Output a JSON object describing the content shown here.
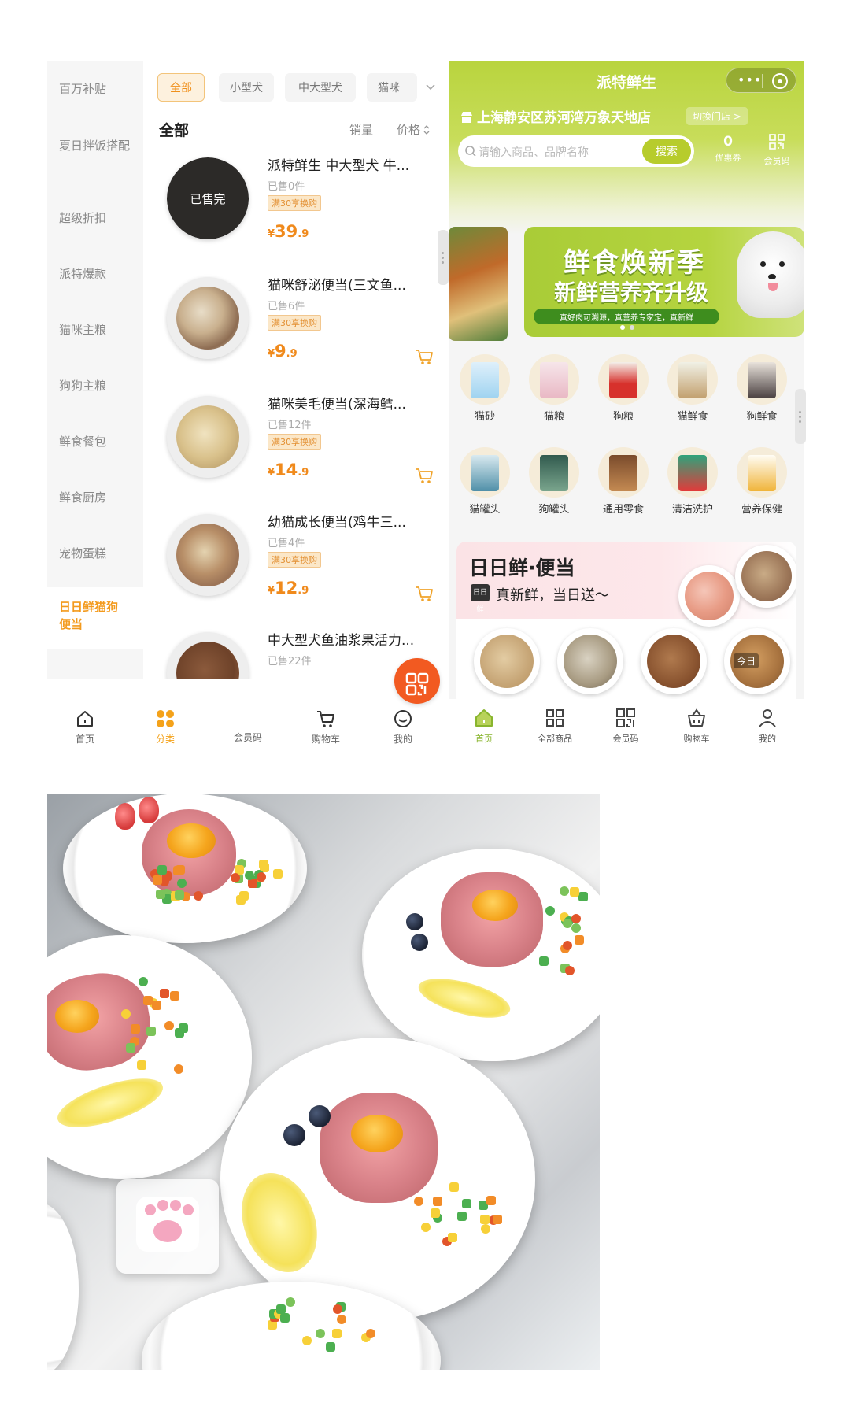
{
  "left_panel": {
    "sidebar": {
      "items": [
        {
          "label": "百万补贴"
        },
        {
          "label": "夏日拌饭搭配"
        },
        {
          "label": "超级折扣"
        },
        {
          "label": "派特爆款"
        },
        {
          "label": "猫咪主粮"
        },
        {
          "label": "狗狗主粮"
        },
        {
          "label": "鲜食餐包"
        },
        {
          "label": "鲜食厨房"
        },
        {
          "label": "宠物蛋糕"
        },
        {
          "label": "日日鲜猫狗便当"
        }
      ],
      "active_index": 9
    },
    "filters": {
      "chips": [
        "全部",
        "小型犬",
        "中大型犬",
        "猫咪"
      ],
      "active": "全部"
    },
    "section_title": "全部",
    "sort": {
      "sales": "销量",
      "price": "价格"
    },
    "products": [
      {
        "name": "派特鲜生 中大型犬 牛...",
        "sold": "已售0件",
        "tag": "满30享换购",
        "price_int": "39",
        "price_dec": ".9",
        "sold_out": true,
        "sold_out_label": "已售完"
      },
      {
        "name": "猫咪舒泌便当(三文鱼...",
        "sold": "已售6件",
        "tag": "满30享换购",
        "price_int": "9",
        "price_dec": ".9",
        "sold_out": false
      },
      {
        "name": "猫咪美毛便当(深海鳕...",
        "sold": "已售12件",
        "tag": "满30享换购",
        "price_int": "14",
        "price_dec": ".9",
        "sold_out": false
      },
      {
        "name": "幼猫成长便当(鸡牛三...",
        "sold": "已售4件",
        "tag": "满30享换购",
        "price_int": "12",
        "price_dec": ".9",
        "sold_out": false
      },
      {
        "name": "中大型犬鱼油浆果活力...",
        "sold": "已售22件",
        "tag": "",
        "price_int": "",
        "price_dec": "",
        "sold_out": false
      }
    ],
    "currency": "¥",
    "tabbar": {
      "items": [
        {
          "label": "首页",
          "icon": "home-icon"
        },
        {
          "label": "分类",
          "icon": "category-icon"
        },
        {
          "label": "会员码",
          "icon": "qr-code-icon"
        },
        {
          "label": "购物车",
          "icon": "cart-icon"
        },
        {
          "label": "我的",
          "icon": "smiley-icon"
        }
      ],
      "active": "分类"
    }
  },
  "right_panel": {
    "app_title": "派特鲜生",
    "store": "上海静安区苏河湾万象天地店",
    "switch_store": "切换门店 >",
    "search_placeholder": "请输入商品、品牌名称",
    "search_button": "搜索",
    "coupon": {
      "count": "0",
      "label": "优惠券"
    },
    "member_code_label": "会员码",
    "banner": {
      "line1": "鲜食焕新季",
      "line2": "新鲜营养齐升级",
      "line3": "真好肉可溯源，真营养专家定，真新鲜"
    },
    "categories": [
      {
        "label": "猫砂"
      },
      {
        "label": "猫粮"
      },
      {
        "label": "狗粮"
      },
      {
        "label": "猫鲜食"
      },
      {
        "label": "狗鲜食"
      },
      {
        "label": "猫罐头"
      },
      {
        "label": "狗罐头"
      },
      {
        "label": "通用零食"
      },
      {
        "label": "清洁洗护"
      },
      {
        "label": "营养保健"
      }
    ],
    "bento": {
      "title": "日日鲜·便当",
      "subtitle": "真新鲜，当日送～",
      "badge": "日日鲜",
      "corner_label": "今日"
    },
    "tabbar": {
      "items": [
        {
          "label": "首页",
          "icon": "home-icon"
        },
        {
          "label": "全部商品",
          "icon": "grid-icon"
        },
        {
          "label": "会员码",
          "icon": "qr-code-icon"
        },
        {
          "label": "购物车",
          "icon": "basket-icon"
        },
        {
          "label": "我的",
          "icon": "user-icon"
        }
      ],
      "active": "首页"
    },
    "colors": {
      "accent": "#b5cf33",
      "price": "#f08a1c",
      "brand_orange": "#f25a21"
    }
  }
}
